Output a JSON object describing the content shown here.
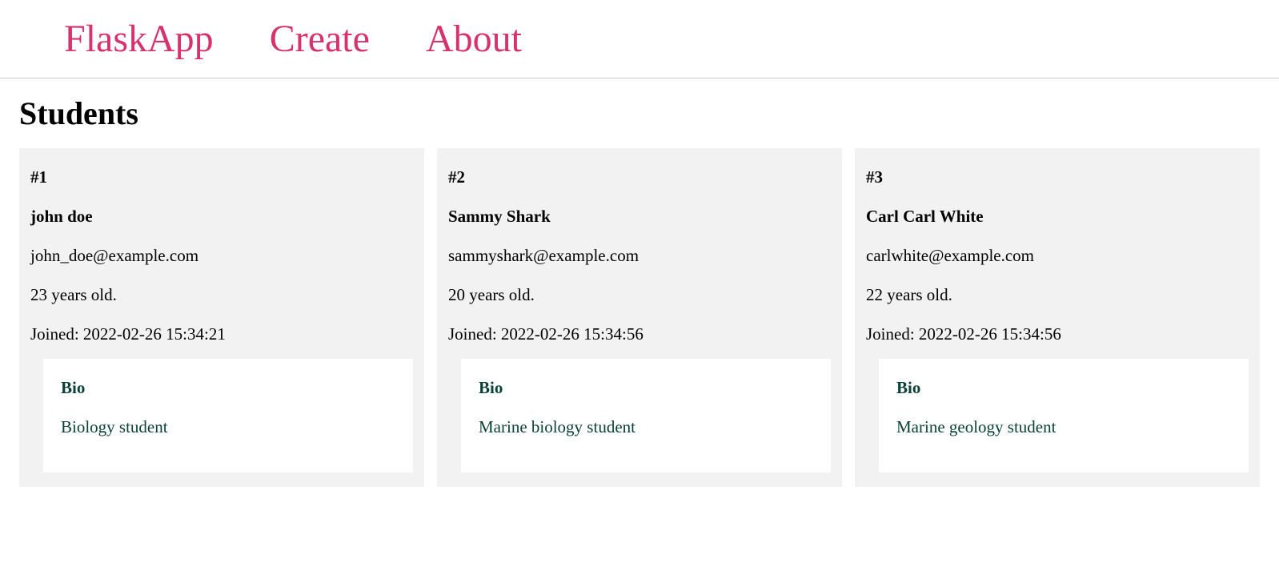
{
  "nav": {
    "brand": "FlaskApp",
    "create": "Create",
    "about": "About"
  },
  "page": {
    "title": "Students",
    "bio_heading": "Bio",
    "joined_prefix": "Joined: ",
    "age_suffix": " years old.",
    "id_prefix": "#"
  },
  "students": [
    {
      "id": "1",
      "name": "john doe",
      "email": "john_doe@example.com",
      "age": "23",
      "joined": "2022-02-26 15:34:21",
      "bio": "Biology student"
    },
    {
      "id": "2",
      "name": "Sammy Shark",
      "email": "sammyshark@example.com",
      "age": "20",
      "joined": "2022-02-26 15:34:56",
      "bio": "Marine biology student"
    },
    {
      "id": "3",
      "name": "Carl Carl White",
      "email": "carlwhite@example.com",
      "age": "22",
      "joined": "2022-02-26 15:34:56",
      "bio": "Marine geology student"
    }
  ]
}
